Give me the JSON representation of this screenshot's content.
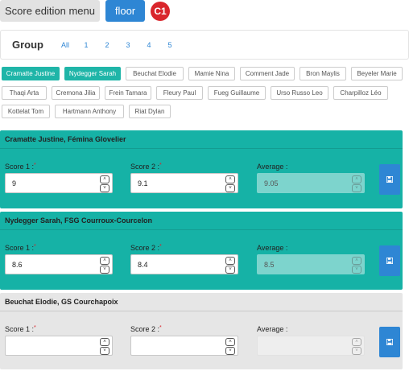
{
  "header": {
    "menu_label": "Score edition menu",
    "apparatus_label": "floor",
    "category_badge": "C1"
  },
  "group_nav": {
    "label": "Group",
    "links": [
      "All",
      "1",
      "2",
      "3",
      "4",
      "5"
    ]
  },
  "gymnasts": [
    {
      "name": "Cramatte Justine",
      "active": true
    },
    {
      "name": "Nydegger Sarah",
      "active": true
    },
    {
      "name": "Beuchat Elodie",
      "active": false
    },
    {
      "name": "Mamie Nina",
      "active": false
    },
    {
      "name": "Comment Jade",
      "active": false
    },
    {
      "name": "Bron Maylis",
      "active": false
    },
    {
      "name": "Beyeler Marie",
      "active": false
    },
    {
      "name": "Thaqi Arta",
      "active": false
    },
    {
      "name": "Cremona Jilia",
      "active": false
    },
    {
      "name": "Frein Tamara",
      "active": false
    },
    {
      "name": "Fleury Paul",
      "active": false
    },
    {
      "name": "Fueg Guillaume",
      "active": false
    },
    {
      "name": "Urso Russo Leo",
      "active": false
    },
    {
      "name": "Charpilloz Léo",
      "active": false
    },
    {
      "name": "Kottelat Tom",
      "active": false
    },
    {
      "name": "Hartmann Anthony",
      "active": false
    },
    {
      "name": "Riat Dylan",
      "active": false
    }
  ],
  "labels": {
    "score1": "Score 1 :",
    "score2": "Score 2 :",
    "average": "Average :",
    "required_mark": "*"
  },
  "score_cards": [
    {
      "title": "Cramatte Justine, Fémina Glovelier",
      "score1": "9",
      "score2": "9.1",
      "average": "9.05",
      "style": "teal"
    },
    {
      "title": "Nydegger Sarah, FSG Courroux-Courcelon",
      "score1": "8.6",
      "score2": "8.4",
      "average": "8.5",
      "style": "teal"
    },
    {
      "title": "Beuchat Elodie, GS Courchapoix",
      "score1": "",
      "score2": "",
      "average": "",
      "style": "grey"
    }
  ],
  "colors": {
    "teal": "#16b2a6",
    "blue": "#2e86d4",
    "badge_red": "#d9262c",
    "required_red": "#d9262c"
  }
}
